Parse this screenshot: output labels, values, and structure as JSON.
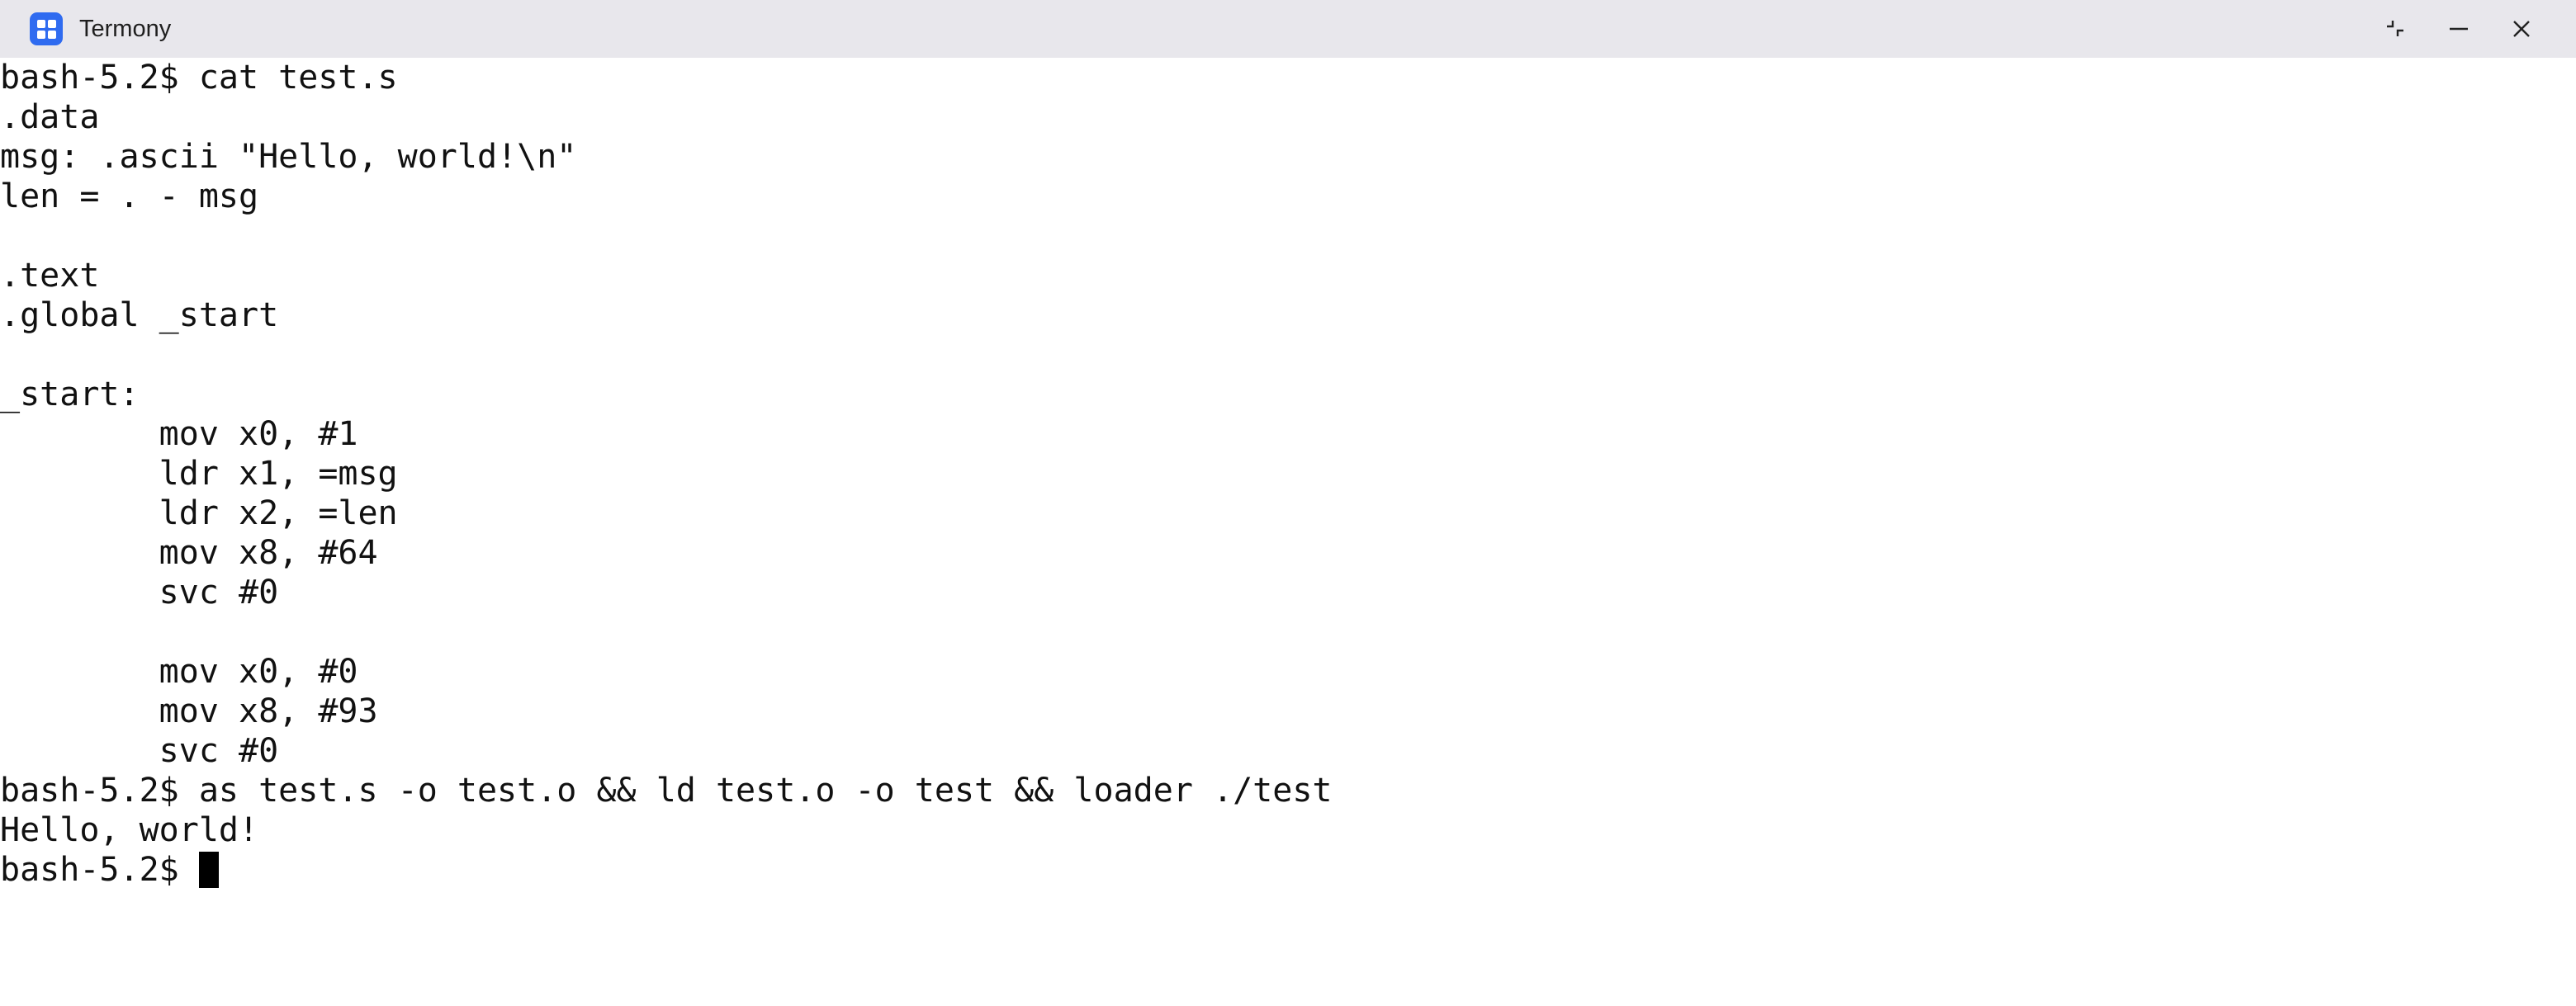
{
  "window": {
    "title": "Termony",
    "app_icon": "app-grid-icon",
    "controls": {
      "restore_icon": "restore-icon",
      "minimize_icon": "minimize-icon",
      "close_icon": "close-icon"
    }
  },
  "terminal": {
    "lines": [
      "bash-5.2$ cat test.s",
      ".data",
      "msg: .ascii \"Hello, world!\\n\"",
      "len = . - msg",
      "",
      ".text",
      ".global _start",
      "",
      "_start:",
      "        mov x0, #1",
      "        ldr x1, =msg",
      "        ldr x2, =len",
      "        mov x8, #64",
      "        svc #0",
      "",
      "        mov x0, #0",
      "        mov x8, #93",
      "        svc #0",
      "bash-5.2$ as test.s -o test.o && ld test.o -o test && loader ./test",
      "Hello, world!"
    ],
    "prompt": "bash-5.2$ "
  },
  "colors": {
    "titlebar_bg": "#e8e7ec",
    "app_icon_bg": "#2f6bf0",
    "terminal_bg": "#ffffff",
    "terminal_text": "#111111"
  }
}
